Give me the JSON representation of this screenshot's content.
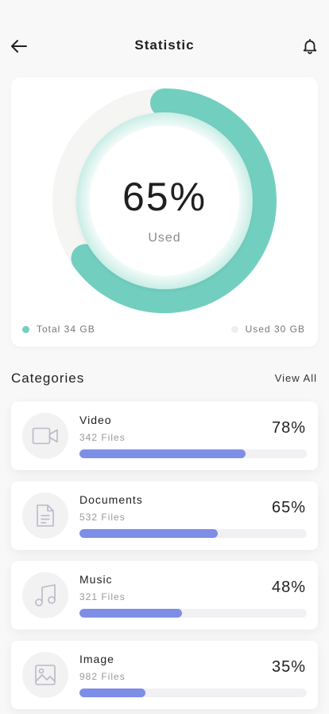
{
  "header": {
    "title": "Statistic",
    "back_icon": "arrow-left-icon",
    "bell_icon": "bell-icon"
  },
  "storage": {
    "used_fraction": 0.65,
    "value_text": "65%",
    "value_label": "Used",
    "accent_color": "#72cfc0",
    "track_color": "#f5f5f3",
    "legend": [
      {
        "label": "Total 34 GB",
        "color": "#72cfc0"
      },
      {
        "label": "Used 30 GB",
        "color": "#eeeeee"
      }
    ]
  },
  "categories": {
    "title": "Categories",
    "view_all": "View All",
    "bar_color": "#7c8ee6",
    "items": [
      {
        "name": "Video",
        "files": "342 Files",
        "percent_text": "78%",
        "percent": 0.73,
        "icon": "video-camera-icon"
      },
      {
        "name": "Documents",
        "files": "532 Files",
        "percent_text": "65%",
        "percent": 0.61,
        "icon": "document-icon"
      },
      {
        "name": "Music",
        "files": "321 Files",
        "percent_text": "48%",
        "percent": 0.45,
        "icon": "music-note-icon"
      },
      {
        "name": "Image",
        "files": "982 Files",
        "percent_text": "35%",
        "percent": 0.29,
        "icon": "image-icon"
      }
    ]
  }
}
